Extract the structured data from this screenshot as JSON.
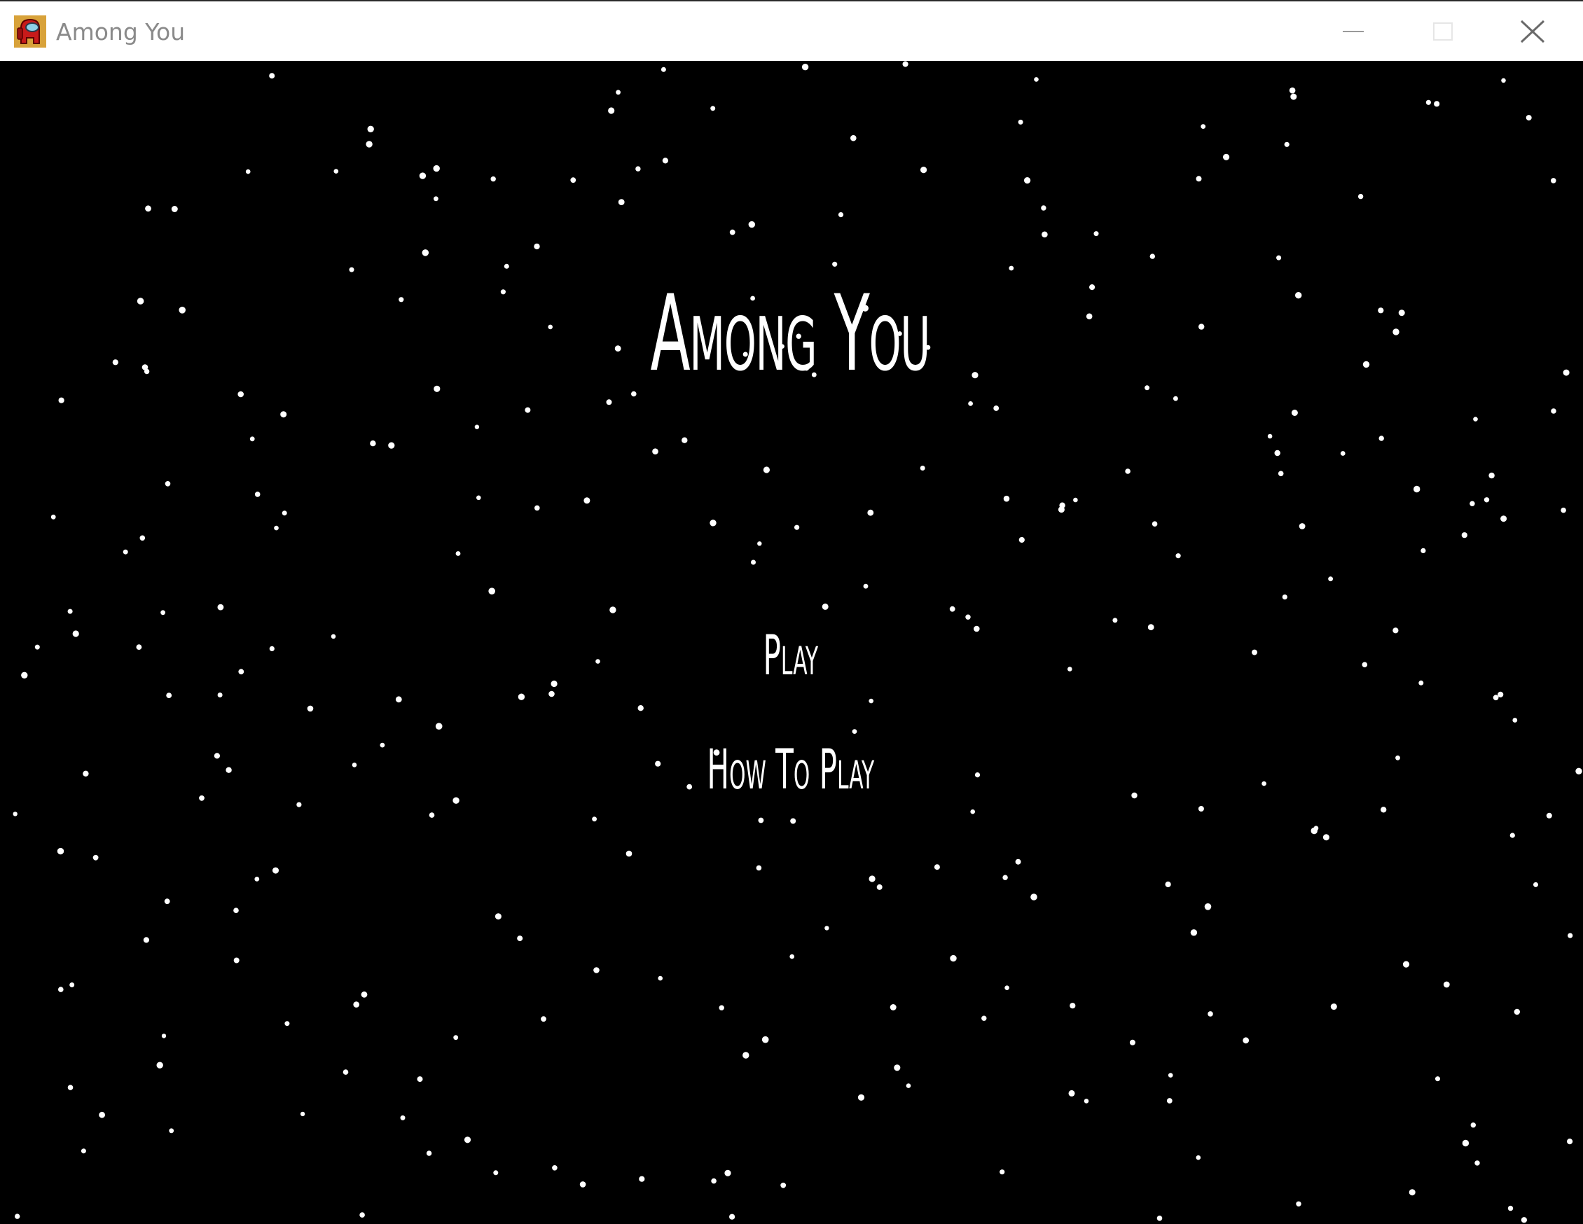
{
  "window": {
    "title": "Among You",
    "app_icon": "red-crewmate-icon",
    "controls": {
      "minimize_icon": "minimize-icon",
      "maximize_icon": "maximize-icon",
      "close_icon": "close-icon"
    }
  },
  "menu": {
    "title": "Among You",
    "play_label": "Play",
    "how_to_play_label": "How To Play"
  },
  "colors": {
    "background": "#000000",
    "stars": "#ffffff",
    "text": "#ffffff",
    "titlebar": "#ffffff"
  }
}
